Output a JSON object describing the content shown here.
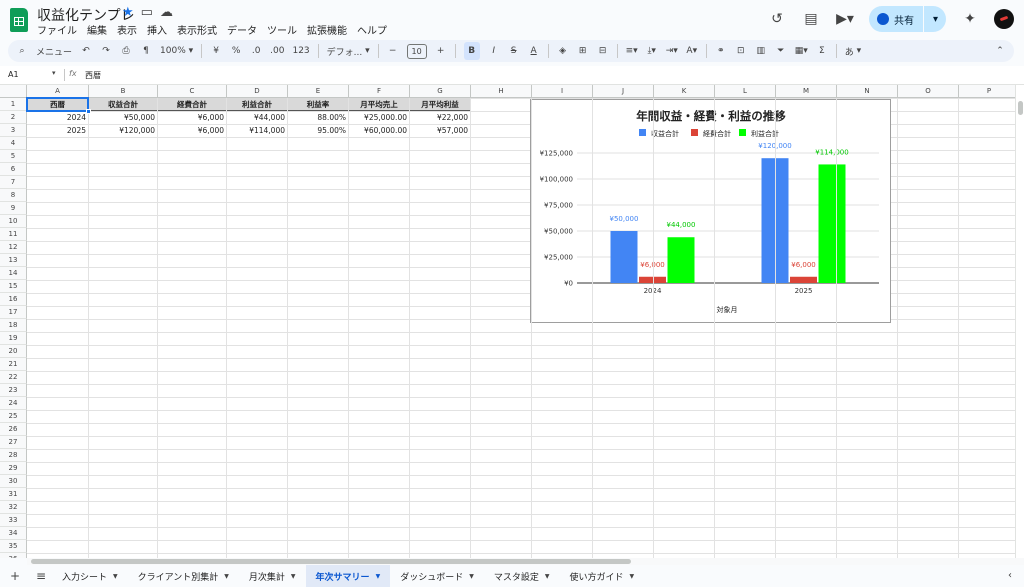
{
  "header": {
    "doc_title": "収益化テンプレ",
    "menu": [
      "ファイル",
      "編集",
      "表示",
      "挿入",
      "表示形式",
      "データ",
      "ツール",
      "拡張機能",
      "ヘルプ"
    ],
    "share_label": "共有"
  },
  "toolbar": {
    "menu_label": "メニュー",
    "zoom": "100%",
    "currency": "¥",
    "percent": "%",
    "dec_decrease": ".0",
    "dec_increase": ".00",
    "number_format": "123",
    "font": "デフォ...",
    "font_size": "10",
    "ime": "あ"
  },
  "formula_bar": {
    "name_box": "A1",
    "fx": "fx",
    "value": "西暦"
  },
  "columns": [
    "A",
    "B",
    "C",
    "D",
    "E",
    "F",
    "G",
    "H",
    "I",
    "J",
    "K",
    "L",
    "M",
    "N",
    "O",
    "P"
  ],
  "rows": [
    "1",
    "2",
    "3",
    "4",
    "5",
    "6",
    "7",
    "8",
    "9",
    "10",
    "11",
    "12",
    "13",
    "14",
    "15",
    "16",
    "17",
    "18",
    "19",
    "20",
    "21",
    "22",
    "23",
    "24",
    "25",
    "26",
    "27",
    "28",
    "29",
    "30",
    "31",
    "32",
    "33",
    "34",
    "35",
    "36"
  ],
  "table": {
    "headers": [
      "西暦",
      "収益合計",
      "経費合計",
      "利益合計",
      "利益率",
      "月平均売上",
      "月平均利益"
    ],
    "rows": [
      [
        "2024",
        "¥50,000",
        "¥6,000",
        "¥44,000",
        "88.00%",
        "¥25,000.00",
        "¥22,000"
      ],
      [
        "2025",
        "¥120,000",
        "¥6,000",
        "¥114,000",
        "95.00%",
        "¥60,000.00",
        "¥57,000"
      ]
    ]
  },
  "chart_data": {
    "type": "bar",
    "title": "年間収益・経費・利益の推移",
    "xlabel": "対象月",
    "ylabel": "",
    "categories": [
      "2024",
      "2025"
    ],
    "series": [
      {
        "name": "収益合計",
        "values": [
          50000,
          120000
        ],
        "labels": [
          "¥50,000",
          "¥120,000"
        ],
        "color": "#4285f4"
      },
      {
        "name": "経費合計",
        "values": [
          6000,
          6000
        ],
        "labels": [
          "¥6,000",
          "¥6,000"
        ],
        "color": "#db4437"
      },
      {
        "name": "利益合計",
        "values": [
          44000,
          114000
        ],
        "labels": [
          "¥44,000",
          "¥114,000"
        ],
        "color": "#00ff00"
      }
    ],
    "ylim": [
      0,
      125000
    ],
    "yticks": [
      "¥0",
      "¥25,000",
      "¥50,000",
      "¥75,000",
      "¥100,000",
      "¥125,000"
    ],
    "legend": "top",
    "grid": true
  },
  "sheet_tabs": [
    {
      "label": "入力シート",
      "active": false
    },
    {
      "label": "クライアント別集計",
      "active": false
    },
    {
      "label": "月次集計",
      "active": false
    },
    {
      "label": "年次サマリー",
      "active": true
    },
    {
      "label": "ダッシュボード",
      "active": false
    },
    {
      "label": "マスタ設定",
      "active": false
    },
    {
      "label": "使い方ガイド",
      "active": false
    }
  ]
}
